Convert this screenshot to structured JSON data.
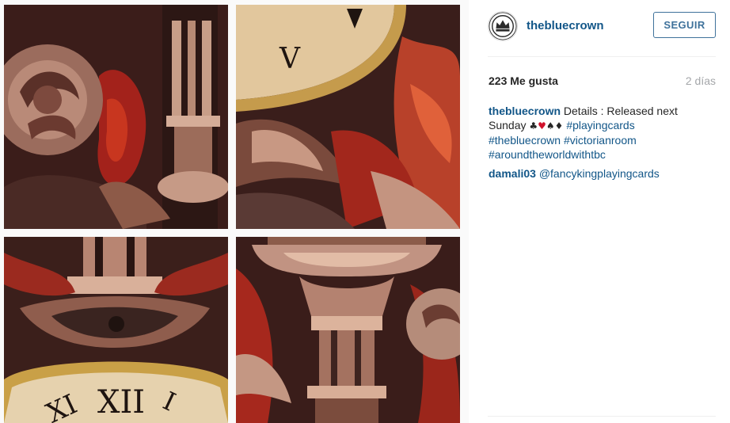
{
  "post": {
    "username": "thebluecrown",
    "follow_label": "SEGUIR",
    "likes": "223 Me gusta",
    "time": "2 días"
  },
  "caption": {
    "user": "thebluecrown",
    "text_1": "Details : Released next",
    "text_2": "Sunday",
    "suit_club": "♣",
    "suit_heart": "♥",
    "suit_spade": "♠",
    "suit_diamond": "♦",
    "tags": [
      "#playingcards",
      "#thebluecrown",
      "#victorianroom",
      "#aroundtheworldwithtbc"
    ]
  },
  "reply": {
    "user": "damali03",
    "mention": "@fancykingplayingcards"
  },
  "colors": {
    "link": "#125688",
    "follow": "#3f729b",
    "muted": "#a5a7aa"
  },
  "media": {
    "tiles": [
      "artwork-tile-top-left",
      "artwork-tile-top-right",
      "artwork-tile-bottom-left",
      "artwork-tile-bottom-right"
    ]
  }
}
